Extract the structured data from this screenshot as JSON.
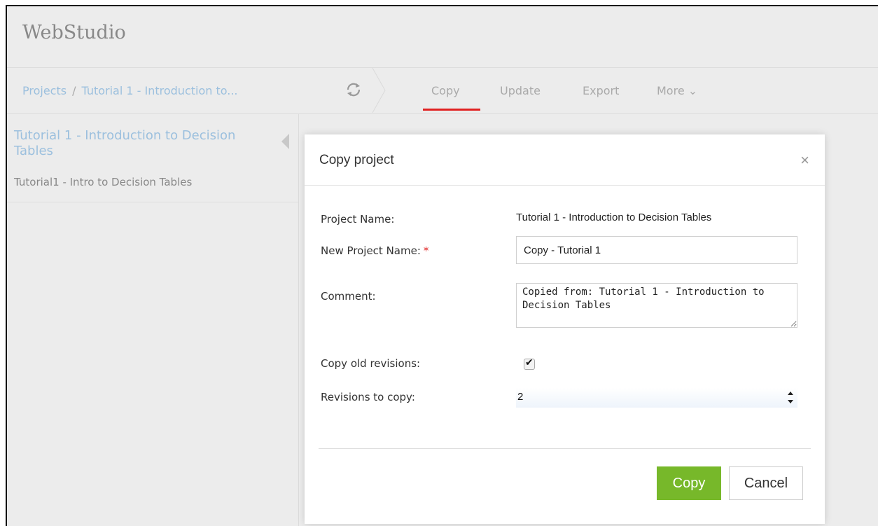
{
  "app": {
    "title": "WebStudio"
  },
  "breadcrumb": {
    "root": "Projects",
    "separator": "/",
    "current": "Tutorial 1 - Introduction to..."
  },
  "tabs": {
    "copy": "Copy",
    "update": "Update",
    "export": "Export",
    "more": "More ⌄"
  },
  "sidebar": {
    "project_title": "Tutorial 1 - Introduction to Decision Tables",
    "project_subtitle": "Tutorial1 - Intro to Decision Tables"
  },
  "dialog": {
    "title": "Copy project",
    "close": "×",
    "project_name_label": "Project Name:",
    "project_name_value": "Tutorial 1 - Introduction to Decision Tables",
    "new_project_name_label": "New Project Name:",
    "required_marker": "*",
    "new_project_name_value": "Copy - Tutorial 1",
    "comment_label": "Comment:",
    "comment_value": "Copied from: Tutorial 1 - Introduction to Decision Tables",
    "copy_old_revisions_label": "Copy old revisions:",
    "copy_old_revisions_checked": true,
    "revisions_to_copy_label": "Revisions to copy:",
    "revisions_to_copy_value": "2",
    "copy_button": "Copy",
    "cancel_button": "Cancel"
  },
  "colors": {
    "accent_red": "#e02020",
    "primary_green": "#77b82a",
    "link_blue": "#9cc0de"
  }
}
